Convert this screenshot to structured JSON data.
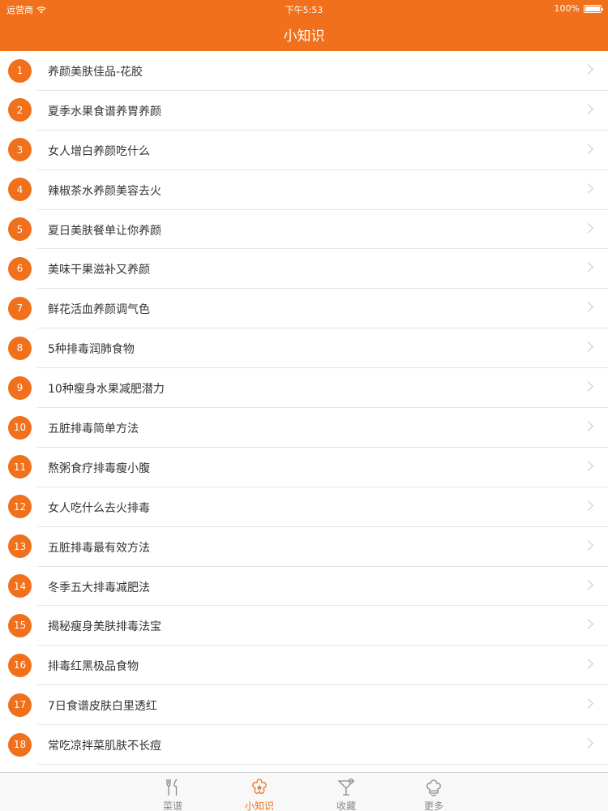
{
  "status_bar": {
    "carrier": "运营商",
    "time": "下午5:53",
    "battery": "100%"
  },
  "header": {
    "title": "小知识"
  },
  "list": {
    "items": [
      {
        "number": "1",
        "label": "养颜美肤佳品-花胶"
      },
      {
        "number": "2",
        "label": "夏季水果食谱养胃养颜"
      },
      {
        "number": "3",
        "label": "女人增白养颜吃什么"
      },
      {
        "number": "4",
        "label": "辣椒茶水养颜美容去火"
      },
      {
        "number": "5",
        "label": "夏日美肤餐单让你养颜"
      },
      {
        "number": "6",
        "label": "美味干果滋补又养颜"
      },
      {
        "number": "7",
        "label": "鲜花活血养颜调气色"
      },
      {
        "number": "8",
        "label": "5种排毒润肺食物"
      },
      {
        "number": "9",
        "label": "10种瘦身水果减肥潜力"
      },
      {
        "number": "10",
        "label": "五脏排毒简单方法"
      },
      {
        "number": "11",
        "label": "熬粥食疗排毒瘦小腹"
      },
      {
        "number": "12",
        "label": "女人吃什么去火排毒"
      },
      {
        "number": "13",
        "label": "五脏排毒最有效方法"
      },
      {
        "number": "14",
        "label": "冬季五大排毒减肥法"
      },
      {
        "number": "15",
        "label": "揭秘瘦身美肤排毒法宝"
      },
      {
        "number": "16",
        "label": "排毒红黑极品食物"
      },
      {
        "number": "17",
        "label": "7日食谱皮肤白里透红"
      },
      {
        "number": "18",
        "label": "常吃凉拌菜肌肤不长痘"
      }
    ]
  },
  "tab_bar": {
    "tabs": [
      {
        "label": "菜谱",
        "icon": "fork-knife-icon",
        "active": false
      },
      {
        "label": "小知识",
        "icon": "star-flower-icon",
        "active": true
      },
      {
        "label": "收藏",
        "icon": "cocktail-icon",
        "active": false
      },
      {
        "label": "更多",
        "icon": "chef-hat-icon",
        "active": false
      }
    ]
  },
  "colors": {
    "accent": "#f0701c",
    "tab_inactive": "#8a8a8a",
    "separator": "#e5e5e5"
  }
}
